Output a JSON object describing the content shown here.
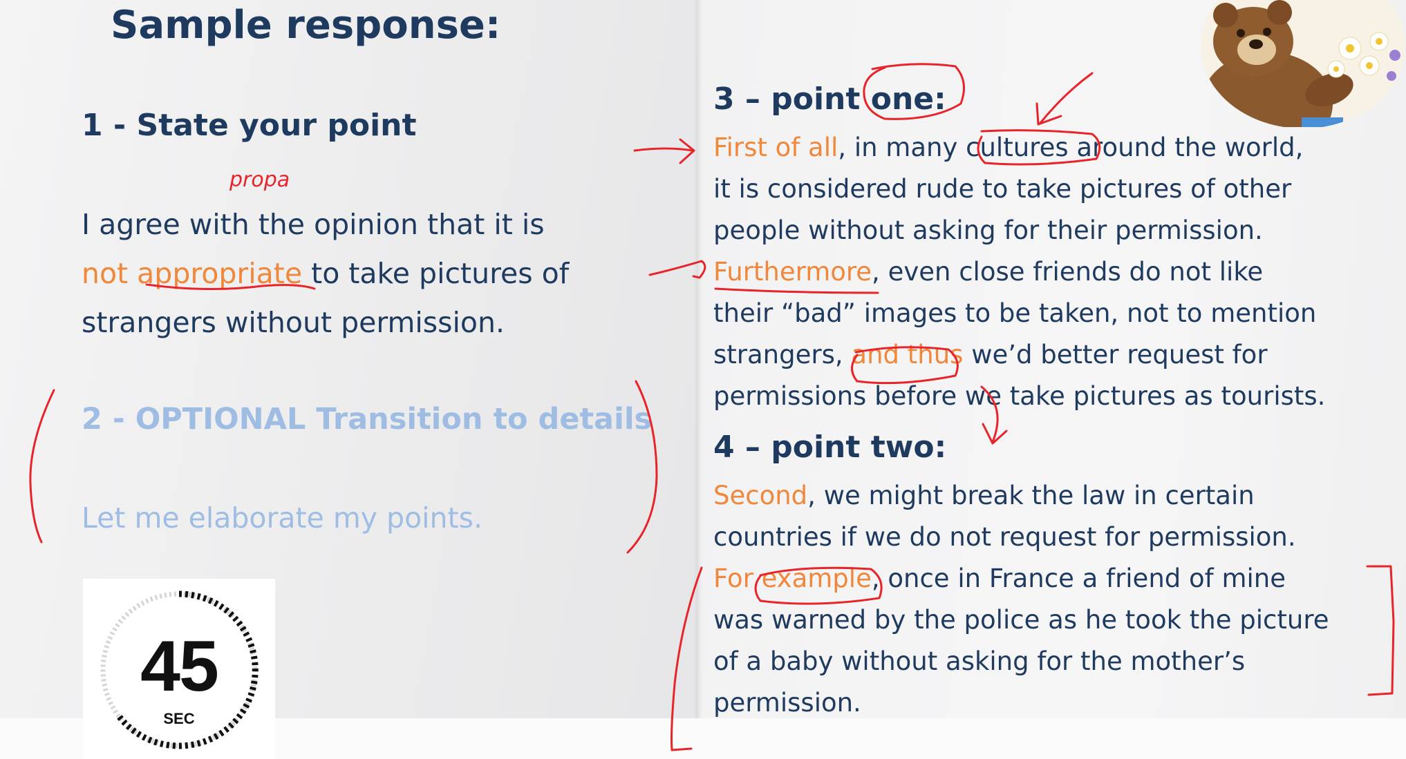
{
  "title": "Sample response:",
  "section1": {
    "heading": "1 - State your point",
    "line1": "I agree with the opinion that it is",
    "line2_orange": "not appropriate",
    "line2_rest": " to take pictures of",
    "line3": "strangers without permission."
  },
  "section2": {
    "heading": "2 - OPTIONAL Transition to details",
    "text": "Let me elaborate my points."
  },
  "section3": {
    "heading": "3 – point one:",
    "l1_orange": "First of all",
    "l1_rest": ", in many cultures around the world,",
    "l2": "it is considered rude to take pictures of other",
    "l3": "people without asking for their permission.",
    "l4_orange": "Furthermore",
    "l4_rest": ", even close friends do not like",
    "l5": "their “bad” images to be taken, not to mention",
    "l6_pre": "strangers, ",
    "l6_orange": "and thus",
    "l6_rest": " we’d better request for",
    "l7": "permissions before we take pictures as tourists."
  },
  "section4": {
    "heading": "4 – point two:",
    "l1_orange": "Second",
    "l1_rest": ", we might break the law in certain",
    "l2": "countries if we do not request for permission.",
    "l3_orange": "For example",
    "l3_rest": ", once in France a friend of mine",
    "l4": "was warned by the police as he took the picture",
    "l5": "of a baby without asking for the mother’s",
    "l6": "permission."
  },
  "timer": {
    "value": "45",
    "unit": "SEC"
  },
  "handwriting": {
    "note": "propa"
  },
  "colors": {
    "navy": "#1f3a5f",
    "orange": "#f0873a",
    "faded_blue": "#9fbde3",
    "ink_red": "#e8242a"
  }
}
